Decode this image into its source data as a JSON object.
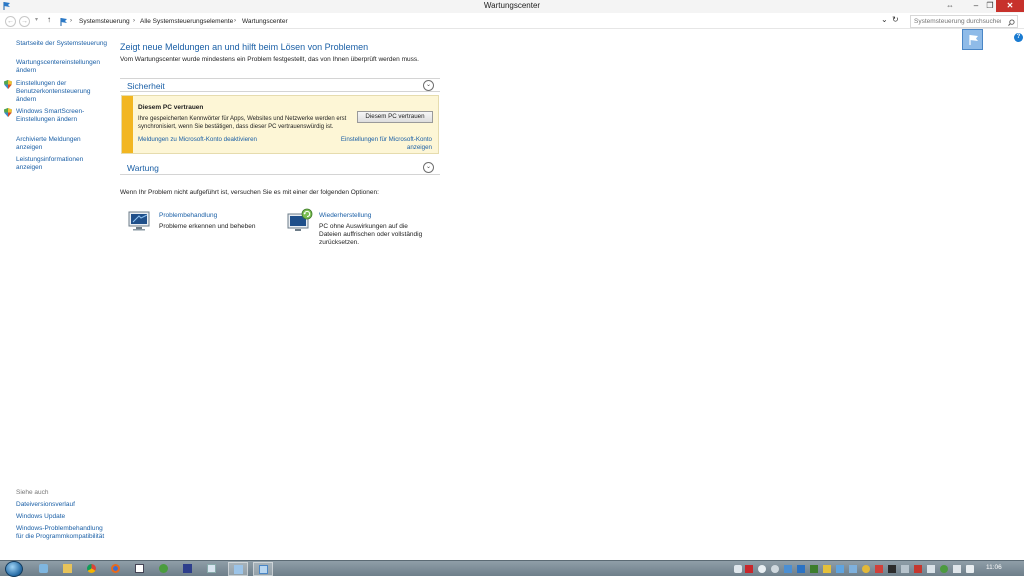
{
  "window": {
    "title": "Wartungscenter",
    "minimize": "–",
    "maximize": "❐",
    "close": "✕",
    "resize": "⇔"
  },
  "address": {
    "crumbs": [
      "Systemsteuerung",
      "Alle Systemsteuerungselemente",
      "Wartungscenter"
    ],
    "separator": "›",
    "search_placeholder": "Systemsteuerung durchsuchen",
    "back": "←",
    "forward": "→",
    "dropdown": "▾",
    "up": "↑",
    "refresh": "↻",
    "chevron_down": "⌄"
  },
  "left_pane": {
    "home": "Startseite der Systemsteuerung",
    "items": [
      {
        "label": "Wartungscentereinstellungen ändern"
      },
      {
        "label": "Einstellungen der Benutzerkontensteuerung ändern"
      },
      {
        "label": "Windows SmartScreen-Einstellungen ändern"
      },
      {
        "label": "Archivierte Meldungen anzeigen"
      },
      {
        "label": "Leistungsinformationen anzeigen"
      }
    ],
    "see_also": "Siehe auch",
    "see_also_items": [
      {
        "label": "Dateiversionsverlauf"
      },
      {
        "label": "Windows Update"
      },
      {
        "label": "Windows-Problembehandlung für die Programmkompatibilität"
      }
    ]
  },
  "main": {
    "title": "Zeigt neue Meldungen an und hilft beim Lösen von Problemen",
    "subtitle": "Vom Wartungscenter wurde mindestens ein Problem festgestellt, das von Ihnen überprüft werden muss.",
    "sections": {
      "security": {
        "label": "Sicherheit",
        "toggle": "⌄"
      },
      "maintenance": {
        "label": "Wartung",
        "toggle": "⌄"
      }
    },
    "alert": {
      "title": "Diesem PC vertrauen",
      "text": "Ihre gespeicherten Kennwörter für Apps, Websites und Netzwerke werden erst synchronisiert, wenn Sie bestätigen, dass dieser PC vertrauenswürdig ist.",
      "button": "Diesem PC vertrauen",
      "link_disable": "Meldungen zu Microsoft-Konto deaktivieren",
      "link_settings": "Einstellungen für Microsoft-Konto anzeigen"
    },
    "maintenance_text": "Wenn Ihr Problem nicht aufgeführt ist, versuchen Sie es mit einer der folgenden Optionen:",
    "options": [
      {
        "title": "Problembehandlung",
        "desc": "Probleme erkennen und beheben",
        "icon": "troubleshoot-icon"
      },
      {
        "title": "Wiederherstellung",
        "desc": "PC ohne Auswirkungen auf die Dateien auffrischen oder vollständig zurücksetzen.",
        "icon": "recovery-icon"
      }
    ],
    "help": "?"
  },
  "taskbar": {
    "clock": "11:06",
    "colors": {
      "bar": "#7d8d98",
      "accent": "#1a5fa6",
      "warning": "#f2b621"
    }
  }
}
